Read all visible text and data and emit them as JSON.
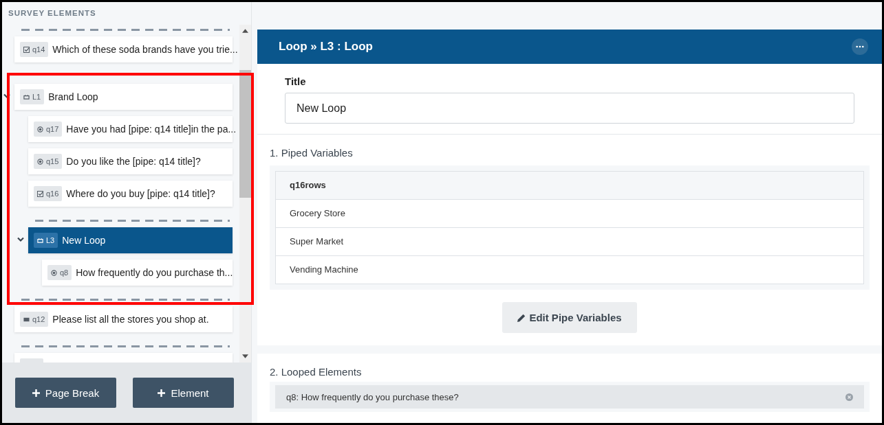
{
  "sidebar": {
    "title": "SURVEY ELEMENTS",
    "items": [
      {
        "kind": "break"
      },
      {
        "kind": "checkbox",
        "tag": "q14",
        "text": "Which of these soda brands have you trie...",
        "selected": false
      },
      {
        "kind": "loop",
        "tag": "L1",
        "text": "Brand Loop",
        "selected": false,
        "expanded": true,
        "children": [
          {
            "kind": "radio",
            "tag": "q17",
            "text": "Have you had [pipe: q14 title]in the pa...",
            "selected": false
          },
          {
            "kind": "radio",
            "tag": "q15",
            "text": "Do you like the [pipe: q14 title]?",
            "selected": false
          },
          {
            "kind": "checkbox",
            "tag": "q16",
            "text": "Where do you buy [pipe: q14 title]?",
            "selected": false
          },
          {
            "kind": "break"
          },
          {
            "kind": "loop",
            "tag": "L3",
            "text": "New Loop",
            "selected": true,
            "expanded": true,
            "children": [
              {
                "kind": "radio",
                "tag": "q8",
                "text": "How frequently do you purchase th...",
                "selected": false
              }
            ]
          }
        ]
      },
      {
        "kind": "break"
      },
      {
        "kind": "text",
        "tag": "q12",
        "text": "Please list all the stores you shop at.",
        "selected": false
      },
      {
        "kind": "break"
      },
      {
        "kind": "hidden"
      }
    ],
    "buttons": [
      {
        "label": "Page Break"
      },
      {
        "label": "Element"
      }
    ]
  },
  "editor": {
    "title": "Loop » L3 : Loop",
    "title_label": "Title",
    "title_value": "New Loop",
    "piped_heading": "1. Piped Variables",
    "table": {
      "column": "q16rows",
      "rows": [
        "Grocery Store",
        "Super Market",
        "Vending Machine"
      ]
    },
    "edit_button": "Edit Pipe Variables",
    "looped_heading": "2. Looped Elements",
    "looped_items": [
      "q8: How frequently do you purchase these?"
    ]
  }
}
